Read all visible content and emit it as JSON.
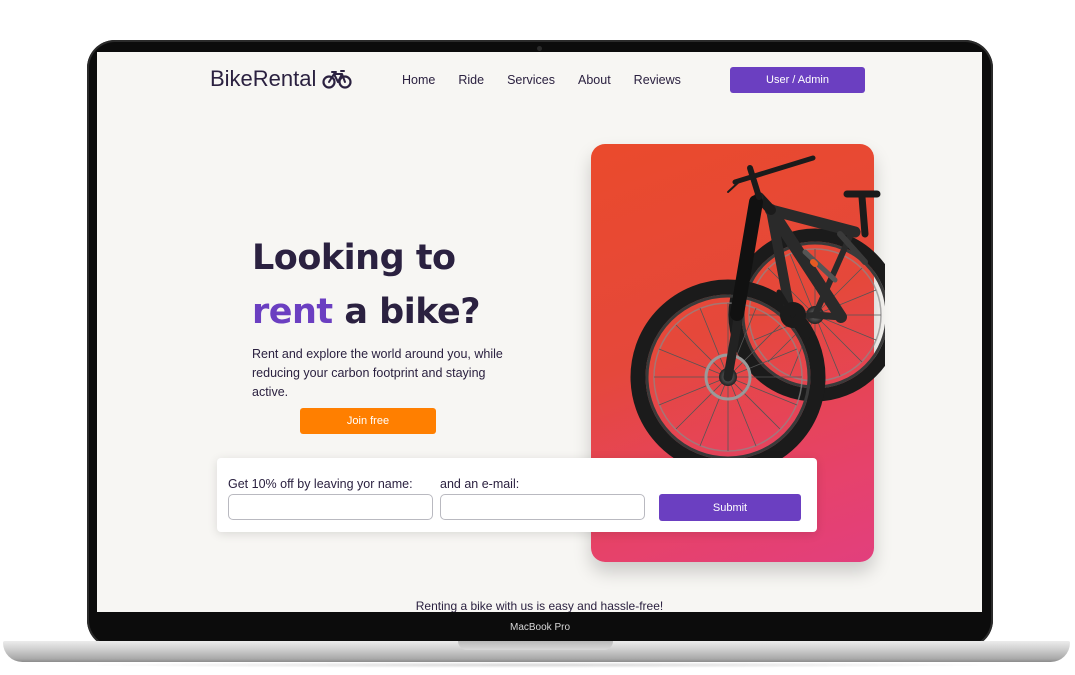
{
  "brand": {
    "name": "BikeRental",
    "logo_icon": "bicycle-icon"
  },
  "nav": {
    "items": [
      {
        "label": "Home"
      },
      {
        "label": "Ride"
      },
      {
        "label": "Services"
      },
      {
        "label": "About"
      },
      {
        "label": "Reviews"
      }
    ],
    "user_button_label": "User / Admin"
  },
  "hero": {
    "line1": "Looking to",
    "line2_accent": "rent",
    "line2_rest": " a bike?",
    "subtitle": "Rent and explore the world around you, while reducing your carbon footprint and staying active.",
    "cta_label": "Join free"
  },
  "signup_form": {
    "name_label": "Get 10% off by leaving yor name:",
    "email_label": "and an e-mail:",
    "name_value": "",
    "email_value": "",
    "submit_label": "Submit"
  },
  "teaser": {
    "text": "Renting a bike with us is easy and hassle-free!"
  },
  "device": {
    "label": "MacBook Pro"
  },
  "colors": {
    "primary": "#6b3fc1",
    "cta": "#ff7f00",
    "text_dark": "#2b2140",
    "card_gradient_top": "#ea4a2c",
    "card_gradient_bottom": "#e23f7d",
    "page_background": "#f7f6f3"
  }
}
